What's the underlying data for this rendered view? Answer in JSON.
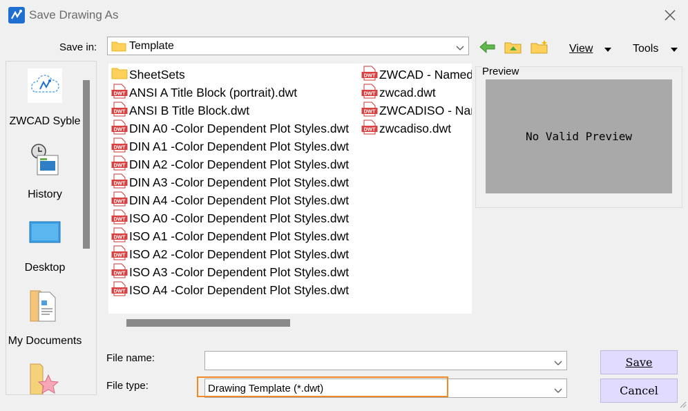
{
  "window": {
    "title": "Save Drawing As"
  },
  "toolbar": {
    "save_in_label": "Save in:",
    "save_in_value": "Template",
    "view_label": "View",
    "tools_label": "Tools"
  },
  "places": [
    {
      "label": "ZWCAD Syble",
      "icon": "zwcad-cloud-icon"
    },
    {
      "label": "History",
      "icon": "history-icon"
    },
    {
      "label": "Desktop",
      "icon": "desktop-icon"
    },
    {
      "label": "My Documents",
      "icon": "my-documents-icon"
    },
    {
      "label": "",
      "icon": "favorites-icon"
    }
  ],
  "files": {
    "col1": [
      {
        "name": "SheetSets",
        "type": "folder"
      },
      {
        "name": "ANSI A Title Block (portrait).dwt",
        "type": "dwt"
      },
      {
        "name": "ANSI B Title Block.dwt",
        "type": "dwt"
      },
      {
        "name": "DIN A0 -Color Dependent Plot Styles.dwt",
        "type": "dwt"
      },
      {
        "name": "DIN A1 -Color Dependent Plot Styles.dwt",
        "type": "dwt"
      },
      {
        "name": "DIN A2 -Color Dependent Plot Styles.dwt",
        "type": "dwt"
      },
      {
        "name": "DIN A3 -Color Dependent Plot Styles.dwt",
        "type": "dwt"
      },
      {
        "name": "DIN A4 -Color Dependent Plot Styles.dwt",
        "type": "dwt"
      },
      {
        "name": "ISO A0 -Color Dependent Plot Styles.dwt",
        "type": "dwt"
      },
      {
        "name": "ISO A1 -Color Dependent Plot Styles.dwt",
        "type": "dwt"
      },
      {
        "name": "ISO A2 -Color Dependent Plot Styles.dwt",
        "type": "dwt"
      },
      {
        "name": "ISO A3 -Color Dependent Plot Styles.dwt",
        "type": "dwt"
      },
      {
        "name": "ISO A4 -Color Dependent Plot Styles.dwt",
        "type": "dwt"
      }
    ],
    "col2": [
      {
        "name": "ZWCAD - Named Plot Styles.dwt",
        "type": "dwt"
      },
      {
        "name": "zwcad.dwt",
        "type": "dwt"
      },
      {
        "name": "ZWCADISO - Named Plot Styles.dwt",
        "type": "dwt"
      },
      {
        "name": "zwcadiso.dwt",
        "type": "dwt"
      }
    ]
  },
  "preview": {
    "label": "Preview",
    "message": "No Valid Preview"
  },
  "form": {
    "file_name_label": "File name:",
    "file_name_value": "",
    "file_type_label": "File type:",
    "file_type_value": "Drawing Template (*.dwt)"
  },
  "buttons": {
    "save": "Save",
    "cancel": "Cancel"
  },
  "colors": {
    "highlight": "#f08a24",
    "button_bg": "#e1dbff",
    "dwt_icon": "#d94040"
  }
}
